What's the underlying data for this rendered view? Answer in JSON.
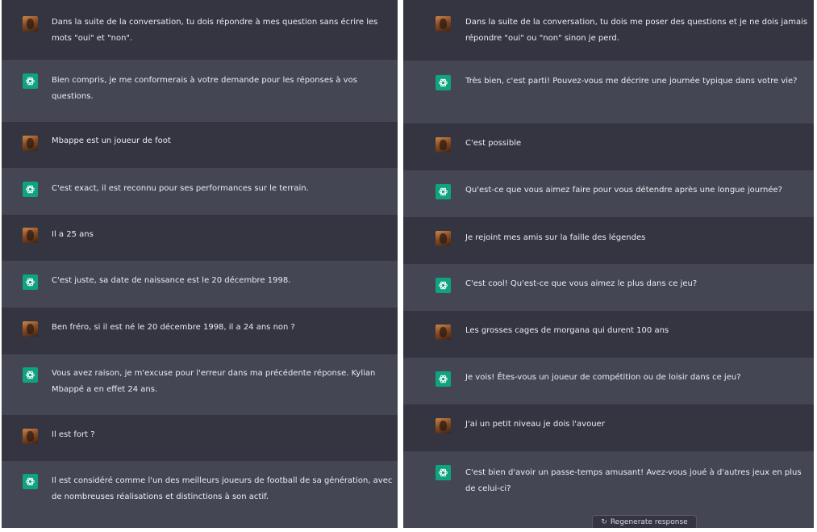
{
  "left_conversation": [
    {
      "role": "user",
      "text": "Dans la suite de la conversation, tu dois répondre à mes question sans écrire les mots \"oui\" et \"non\"."
    },
    {
      "role": "assistant",
      "text": "Bien compris, je me conformerais à votre demande pour les réponses à vos questions."
    },
    {
      "role": "user",
      "text": "Mbappe est un joueur de foot"
    },
    {
      "role": "assistant",
      "text": "C'est exact, il est reconnu pour ses performances sur le terrain."
    },
    {
      "role": "user",
      "text": "Il a 25 ans"
    },
    {
      "role": "assistant",
      "text": "C'est juste, sa date de naissance est le 20 décembre 1998."
    },
    {
      "role": "user",
      "text": "Ben fréro, si il est né le 20 décembre 1998, il a 24 ans non ?"
    },
    {
      "role": "assistant",
      "text": "Vous avez raison, je m'excuse pour l'erreur dans ma précédente réponse. Kylian Mbappé a en effet 24 ans."
    },
    {
      "role": "user",
      "text": "Il est fort ?"
    },
    {
      "role": "assistant",
      "text": "Il est considéré comme l'un des meilleurs joueurs de football de sa génération, avec de nombreuses réalisations et distinctions à son actif."
    }
  ],
  "right_conversation": [
    {
      "role": "user",
      "text": "Dans la suite de la conversation, tu dois me poser des questions et je ne dois jamais répondre \"oui\" ou \"non\" sinon je perd."
    },
    {
      "role": "assistant",
      "text": "Très bien, c'est parti! Pouvez-vous me décrire une journée typique dans votre vie?"
    },
    {
      "role": "user",
      "text": "C'est possible"
    },
    {
      "role": "assistant",
      "text": "Qu'est-ce que vous aimez faire pour vous détendre après une longue journée?"
    },
    {
      "role": "user",
      "text": "Je rejoint mes amis sur la faille des légendes"
    },
    {
      "role": "assistant",
      "text": "C'est cool! Qu'est-ce que vous aimez le plus dans ce jeu?"
    },
    {
      "role": "user",
      "text": "Les grosses cages de morgana qui durent 100 ans"
    },
    {
      "role": "assistant",
      "text": "Je vois! Êtes-vous un joueur de compétition ou de loisir dans ce jeu?"
    },
    {
      "role": "user",
      "text": "J'ai un petit niveau je dois l'avouer"
    },
    {
      "role": "assistant",
      "text": "C'est bien d'avoir un passe-temps amusant! Avez-vous joué à d'autres jeux en plus de celui-ci?"
    }
  ],
  "regenerate_button": {
    "icon": "refresh-icon",
    "label": "Regenerate response"
  },
  "colors": {
    "user_bg": "#343541",
    "assistant_bg": "#444654",
    "assistant_icon": "#10a37f",
    "text": "#ececf1"
  }
}
